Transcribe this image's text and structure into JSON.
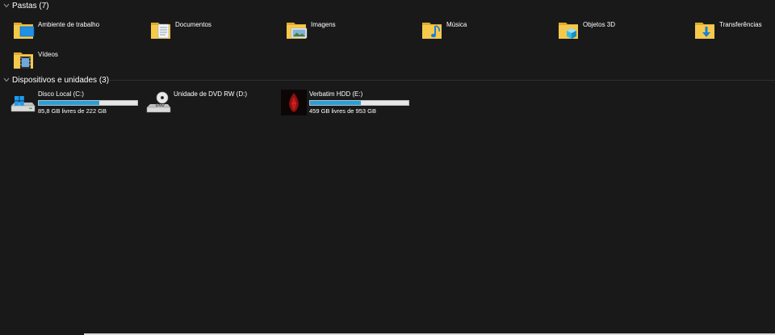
{
  "folders_section": {
    "title": "Pastas (7)",
    "items": [
      {
        "label": "Ambiente de trabalho",
        "icon": "desktop-folder-icon"
      },
      {
        "label": "Documentos",
        "icon": "documents-folder-icon"
      },
      {
        "label": "Imagens",
        "icon": "pictures-folder-icon"
      },
      {
        "label": "Música",
        "icon": "music-folder-icon"
      },
      {
        "label": "Objetos 3D",
        "icon": "3d-objects-folder-icon"
      },
      {
        "label": "Transferências",
        "icon": "downloads-folder-icon"
      },
      {
        "label": "Vídeos",
        "icon": "videos-folder-icon"
      }
    ]
  },
  "drives_section": {
    "title": "Dispositivos e unidades (3)",
    "items": [
      {
        "label": "Disco Local (C:)",
        "free_text": "85,8 GB livres de 222 GB",
        "used_fraction": 0.614,
        "icon": "windows-drive-icon"
      },
      {
        "label": "Unidade de DVD RW (D:)",
        "icon": "dvd-drive-icon"
      },
      {
        "label": "Verbatim HDD (E:)",
        "free_text": "459 GB livres de 953 GB",
        "used_fraction": 0.518,
        "icon": "verbatim-drive-icon"
      }
    ]
  },
  "colors": {
    "background": "#191919",
    "bar_fill": "#26a0da",
    "bar_track": "#e6e6e6",
    "folder_yellow": "#f5c94c"
  }
}
